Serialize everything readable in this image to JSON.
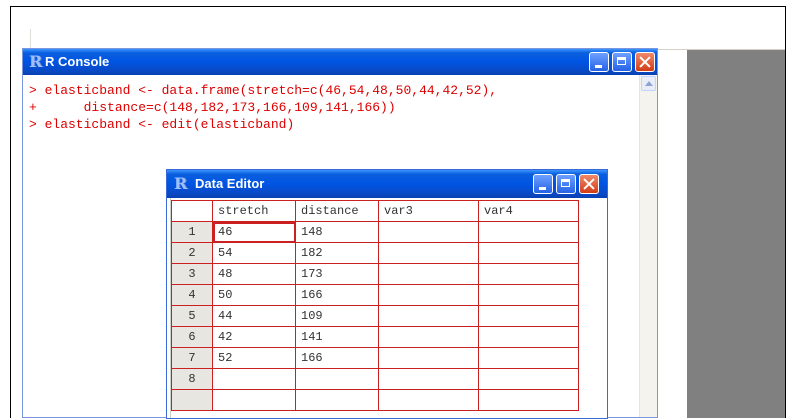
{
  "console": {
    "title": "R Console",
    "lines": [
      "> elasticband <- data.frame(stretch=c(46,54,48,50,44,42,52),",
      "+      distance=c(148,182,173,166,109,141,166))",
      "> elasticband <- edit(elasticband)"
    ],
    "logo": "R"
  },
  "editor": {
    "title": "Data Editor",
    "logo": "R",
    "columns": [
      "stretch",
      "distance",
      "var3",
      "var4"
    ],
    "rows": [
      {
        "num": "1",
        "cells": [
          "46",
          "148",
          "",
          ""
        ]
      },
      {
        "num": "2",
        "cells": [
          "54",
          "182",
          "",
          ""
        ]
      },
      {
        "num": "3",
        "cells": [
          "48",
          "173",
          "",
          ""
        ]
      },
      {
        "num": "4",
        "cells": [
          "50",
          "166",
          "",
          ""
        ]
      },
      {
        "num": "5",
        "cells": [
          "44",
          "109",
          "",
          ""
        ]
      },
      {
        "num": "6",
        "cells": [
          "42",
          "141",
          "",
          ""
        ]
      },
      {
        "num": "7",
        "cells": [
          "52",
          "166",
          "",
          ""
        ]
      },
      {
        "num": "8",
        "cells": [
          "",
          "",
          "",
          ""
        ]
      },
      {
        "num": "",
        "cells": [
          "",
          "",
          "",
          ""
        ]
      }
    ]
  },
  "icons": {
    "minimize": "minimize-icon",
    "maximize": "maximize-icon",
    "close": "close-icon",
    "scroll_up": "scroll-up-arrow-icon"
  }
}
